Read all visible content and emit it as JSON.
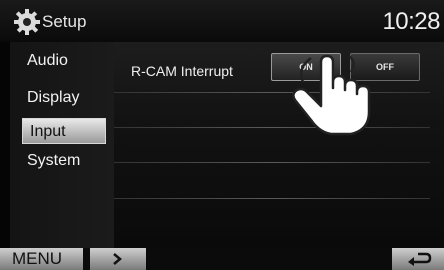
{
  "header": {
    "title": "Setup",
    "clock": "10:28",
    "icon": "gear-icon"
  },
  "sidebar": {
    "items": [
      {
        "label": "Audio"
      },
      {
        "label": "Display"
      },
      {
        "label": "Input",
        "selected": true
      },
      {
        "label": "System"
      }
    ]
  },
  "main": {
    "setting": {
      "label": "R-CAM Interrupt",
      "options": [
        "ON",
        "OFF"
      ],
      "selected": "ON"
    }
  },
  "footer": {
    "menu_label": "MENU",
    "next_icon": "chevron-right-icon",
    "back_icon": "return-arrow-icon"
  },
  "overlay": {
    "icon": "pointing-hand-icon"
  }
}
